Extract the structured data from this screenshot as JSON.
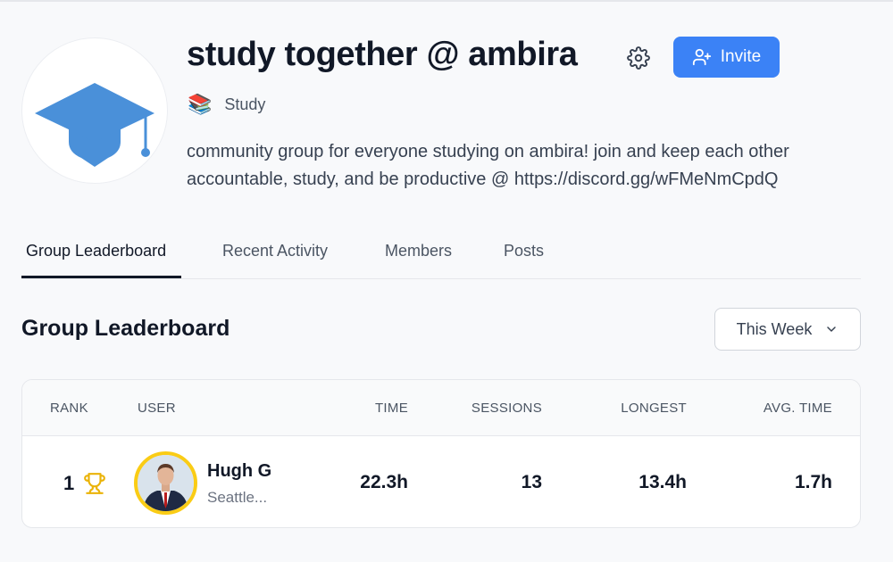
{
  "group": {
    "title": "study together @ ambira",
    "icon": "graduation-cap-icon",
    "category_emoji": "📚",
    "category": "Study",
    "description": "community group for everyone studying on ambira! join and keep each other accountable, study, and be productive @ https://discord.gg/wFMeNmCpdQ",
    "invite_label": "Invite"
  },
  "tabs": [
    {
      "label": "Group Leaderboard",
      "active": true
    },
    {
      "label": "Recent Activity",
      "active": false
    },
    {
      "label": "Members",
      "active": false
    },
    {
      "label": "Posts",
      "active": false
    }
  ],
  "leaderboard": {
    "title": "Group Leaderboard",
    "period": "This Week",
    "columns": {
      "rank": "RANK",
      "user": "USER",
      "time": "TIME",
      "sessions": "SESSIONS",
      "longest": "LONGEST",
      "avg": "AVG. TIME"
    },
    "rows": [
      {
        "rank": "1",
        "name": "Hugh G",
        "location": "Seattle...",
        "time": "22.3h",
        "sessions": "13",
        "longest": "13.4h",
        "avg": "1.7h"
      }
    ]
  },
  "colors": {
    "accent": "#3b82f6",
    "cap": "#4a90d9",
    "gold": "#facc15"
  }
}
